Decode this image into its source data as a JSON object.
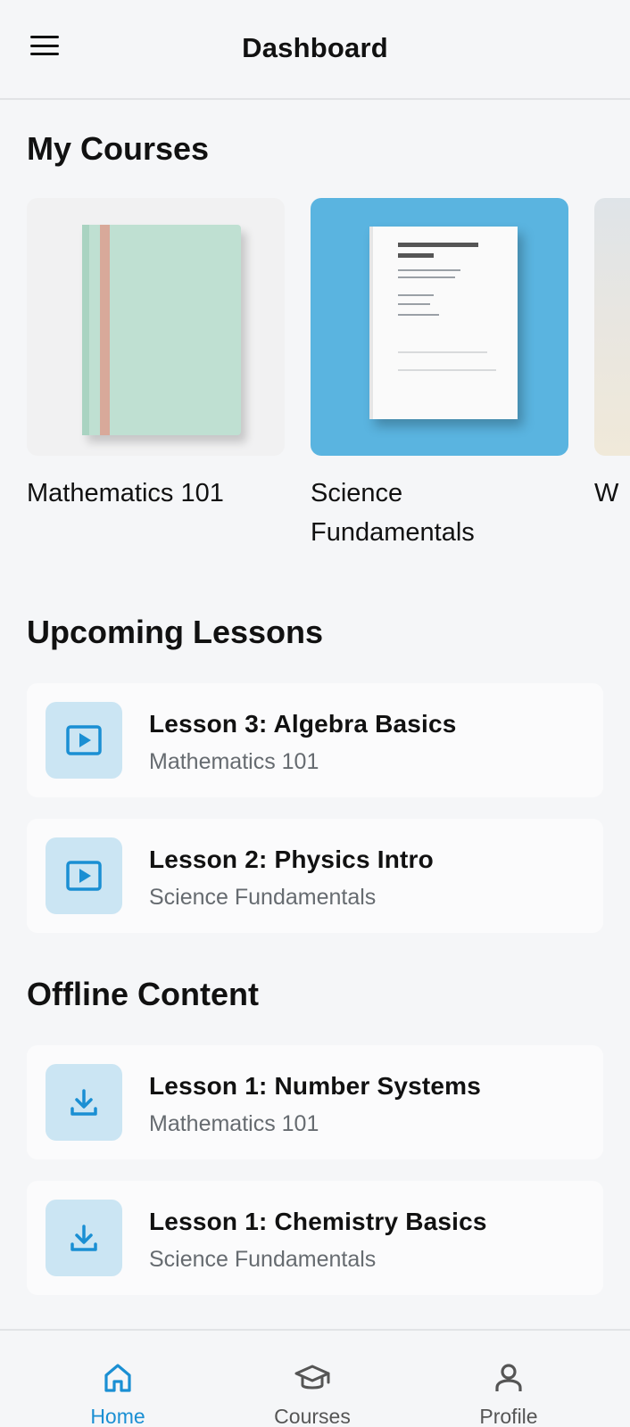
{
  "header": {
    "title": "Dashboard",
    "menu_icon": "menu-icon"
  },
  "sections": {
    "my_courses": "My Courses",
    "upcoming_lessons": "Upcoming Lessons",
    "offline_content": "Offline Content"
  },
  "courses": [
    {
      "name": "Mathematics 101"
    },
    {
      "name": "Science Fundamentals"
    },
    {
      "name": "W"
    }
  ],
  "upcoming": [
    {
      "title": "Lesson 3: Algebra Basics",
      "course": "Mathematics 101",
      "icon": "play-icon"
    },
    {
      "title": "Lesson 2: Physics Intro",
      "course": "Science Fundamentals",
      "icon": "play-icon"
    }
  ],
  "offline": [
    {
      "title": "Lesson 1: Number Systems",
      "course": "Mathematics 101",
      "icon": "download-icon"
    },
    {
      "title": "Lesson 1: Chemistry Basics",
      "course": "Science Fundamentals",
      "icon": "download-icon"
    }
  ],
  "nav": [
    {
      "label": "Home",
      "icon": "home-icon",
      "active": true
    },
    {
      "label": "Courses",
      "icon": "graduation-cap-icon",
      "active": false
    },
    {
      "label": "Profile",
      "icon": "person-icon",
      "active": false
    }
  ],
  "colors": {
    "accent": "#1a8fd3",
    "icon_bg": "#cbe5f3",
    "background": "#f5f6f8",
    "card_bg": "#fbfbfc"
  }
}
